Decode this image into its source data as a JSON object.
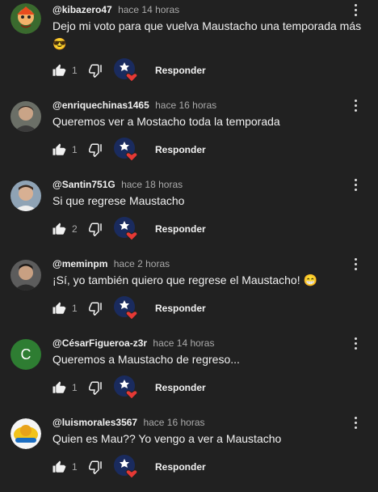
{
  "comments": [
    {
      "author": "@kibazero47",
      "time": "hace 14 horas",
      "text": "Dejo mi voto para que vuelva Maustacho una temporada más 😎",
      "likes": "1",
      "reply": "Responder",
      "avatar": "cartoon"
    },
    {
      "author": "@enriquechinas1465",
      "time": "hace 16 horas",
      "text": "Queremos ver a Mostacho toda la temporada",
      "likes": "1",
      "reply": "Responder",
      "avatar": "photo"
    },
    {
      "author": "@Santin751G",
      "time": "hace 18 horas",
      "text": "Si que regrese Maustacho",
      "likes": "2",
      "reply": "Responder",
      "avatar": "photo"
    },
    {
      "author": "@meminpm",
      "time": "hace 2 horas",
      "text": "¡Sí, yo también quiero que regrese el Maustacho! 😁",
      "likes": "1",
      "reply": "Responder",
      "avatar": "photo"
    },
    {
      "author": "@CésarFigueroa-z3r",
      "time": "hace 14 horas",
      "text": "Queremos a Maustacho de regreso...",
      "likes": "1",
      "reply": "Responder",
      "avatar": "letter",
      "initial": "C",
      "avatar_color": "#2e7d32"
    },
    {
      "author": "@luismorales3567",
      "time": "hace 16 horas",
      "text": "Quien es Mau?? Yo vengo a ver a Maustacho",
      "likes": "1",
      "reply": "Responder",
      "avatar": "cartoon"
    }
  ]
}
